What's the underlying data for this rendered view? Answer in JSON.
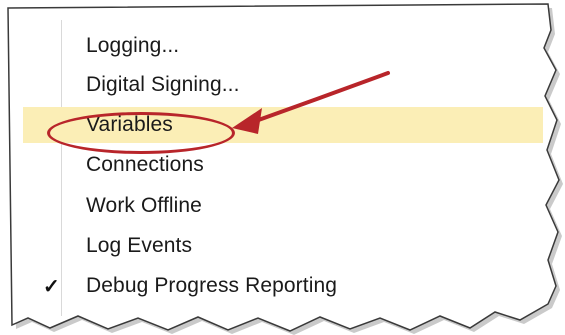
{
  "menu": {
    "items": [
      {
        "label": "Logging...",
        "checked": false,
        "highlighted": false
      },
      {
        "label": "Digital Signing...",
        "checked": false,
        "highlighted": false
      },
      {
        "label": "Variables",
        "checked": false,
        "highlighted": true
      },
      {
        "label": "Connections",
        "checked": false,
        "highlighted": false
      },
      {
        "label": "Work Offline",
        "checked": false,
        "highlighted": false
      },
      {
        "label": "Log Events",
        "checked": false,
        "highlighted": false
      },
      {
        "label": "Debug Progress Reporting",
        "checked": true,
        "highlighted": false
      }
    ],
    "check_glyph": "✓"
  },
  "colors": {
    "highlight": "#fbeeb6",
    "callout": "#b8252a"
  }
}
